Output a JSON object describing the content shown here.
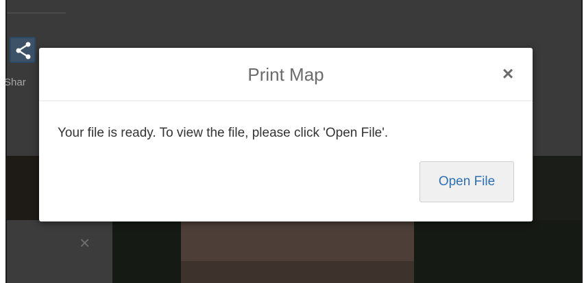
{
  "background": {
    "share_label": "Shar",
    "panel_close": "×"
  },
  "dialog": {
    "title": "Print Map",
    "close_glyph": "×",
    "message": "Your file is ready. To view the file, please click 'Open File'.",
    "open_button_label": "Open File"
  },
  "colors": {
    "overlay": "#3a3a3a",
    "dialog_bg": "#ffffff",
    "title_text": "#6b6b6b",
    "message_text": "#333333",
    "button_text": "#2d6fb5",
    "button_bg": "#f0f0f0"
  },
  "icons": [
    "share-icon",
    "close-icon"
  ]
}
